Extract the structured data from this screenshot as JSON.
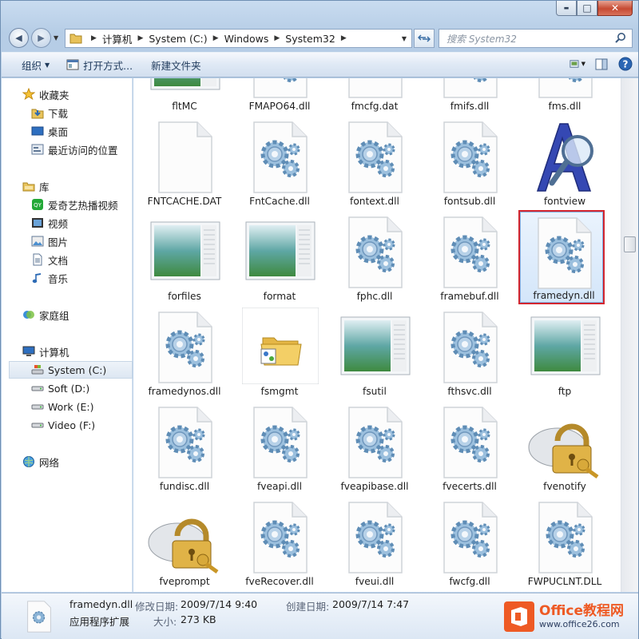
{
  "window": {
    "controls": {
      "minimize": "▬",
      "maximize": "□",
      "close": "✕"
    }
  },
  "nav": {
    "back": "◀",
    "forward": "▶",
    "breadcrumbs": [
      "计算机",
      "System (C:)",
      "Windows",
      "System32"
    ],
    "search_placeholder": "搜索 System32"
  },
  "toolbar": {
    "organize": "组织",
    "open_with": "打开方式...",
    "new_folder": "新建文件夹"
  },
  "sidebar": {
    "favorites": "收藏夹",
    "downloads": "下载",
    "desktop": "桌面",
    "recent": "最近访问的位置",
    "libraries": "库",
    "iqiyi": "爱奇艺热播视频",
    "videos": "视频",
    "pictures": "图片",
    "documents": "文档",
    "music": "音乐",
    "homegroup": "家庭组",
    "computer": "计算机",
    "drive_c": "System (C:)",
    "drive_d": "Soft (D:)",
    "drive_e": "Work (E:)",
    "drive_f": "Video (F:)",
    "network": "网络"
  },
  "files": [
    {
      "name": "fltMC",
      "icon": "exe-window"
    },
    {
      "name": "FMAPO64.dll",
      "icon": "dll-gears"
    },
    {
      "name": "fmcfg.dat",
      "icon": "blank-file"
    },
    {
      "name": "fmifs.dll",
      "icon": "dll-gears"
    },
    {
      "name": "fms.dll",
      "icon": "dll-gears"
    },
    {
      "name": "FNTCACHE.DAT",
      "icon": "blank-file"
    },
    {
      "name": "FntCache.dll",
      "icon": "dll-gears"
    },
    {
      "name": "fontext.dll",
      "icon": "dll-gears"
    },
    {
      "name": "fontsub.dll",
      "icon": "dll-gears"
    },
    {
      "name": "fontview",
      "icon": "font-viewer"
    },
    {
      "name": "forfiles",
      "icon": "exe-window"
    },
    {
      "name": "format",
      "icon": "exe-window"
    },
    {
      "name": "fphc.dll",
      "icon": "dll-gears"
    },
    {
      "name": "framebuf.dll",
      "icon": "dll-gears"
    },
    {
      "name": "framedyn.dll",
      "icon": "dll-gears"
    },
    {
      "name": "framedynos.dll",
      "icon": "dll-gears"
    },
    {
      "name": "fsmgmt",
      "icon": "folder-share"
    },
    {
      "name": "fsutil",
      "icon": "exe-window"
    },
    {
      "name": "fthsvc.dll",
      "icon": "dll-gears"
    },
    {
      "name": "ftp",
      "icon": "exe-window"
    },
    {
      "name": "fundisc.dll",
      "icon": "dll-gears"
    },
    {
      "name": "fveapi.dll",
      "icon": "dll-gears"
    },
    {
      "name": "fveapibase.dll",
      "icon": "dll-gears"
    },
    {
      "name": "fvecerts.dll",
      "icon": "dll-gears"
    },
    {
      "name": "fvenotify",
      "icon": "bitlocker-lock"
    },
    {
      "name": "fveprompt",
      "icon": "bitlocker-lock"
    },
    {
      "name": "fveRecover.dll",
      "icon": "dll-gears"
    },
    {
      "name": "fveui.dll",
      "icon": "dll-gears"
    },
    {
      "name": "fwcfg.dll",
      "icon": "dll-gears"
    },
    {
      "name": "FWPUCLNT.DLL",
      "icon": "dll-gears"
    }
  ],
  "selected_file": "framedyn.dll",
  "details": {
    "name": "framedyn.dll",
    "type": "应用程序扩展",
    "modified_label": "修改日期:",
    "modified_value": "2009/7/14 9:40",
    "created_label": "创建日期:",
    "created_value": "2009/7/14 7:47",
    "size_label": "大小:",
    "size_value": "273 KB"
  },
  "watermark": {
    "title": "Office教程网",
    "url": "www.office26.com"
  },
  "colors": {
    "highlight_border": "#d3262f",
    "brand_orange": "#ee5a24"
  }
}
